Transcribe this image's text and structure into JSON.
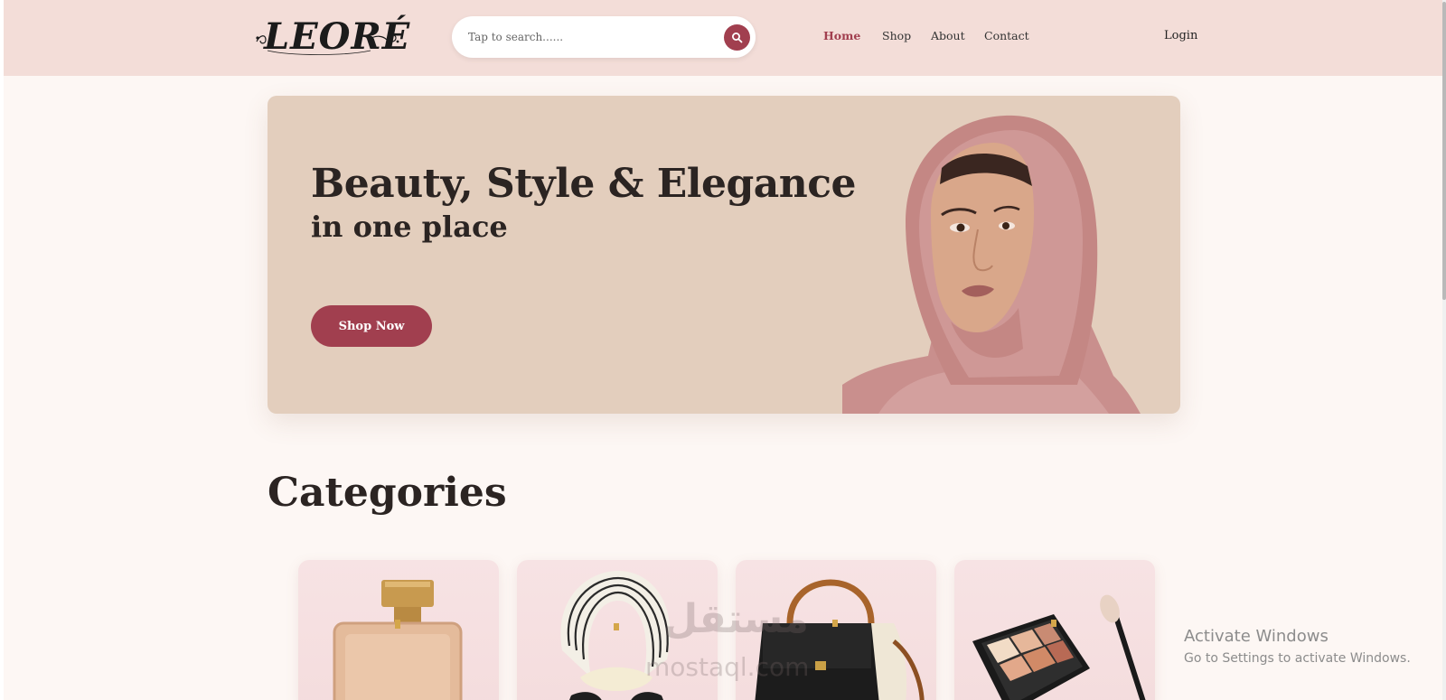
{
  "header": {
    "logo_text": "LEORÉ",
    "search": {
      "placeholder": "Tap to search......"
    },
    "nav": [
      {
        "label": "Home",
        "active": true
      },
      {
        "label": "Shop",
        "active": false
      },
      {
        "label": "About",
        "active": false
      },
      {
        "label": "Contact",
        "active": false
      }
    ],
    "login_label": "Login"
  },
  "hero": {
    "title": "Beauty, Style & Elegance",
    "subtitle": "in one place",
    "cta_label": "Shop Now"
  },
  "categories": {
    "heading": "Categories",
    "cards": [
      {
        "icon": "perfume-bottle-image"
      },
      {
        "icon": "silk-scarf-image"
      },
      {
        "icon": "handbag-image"
      },
      {
        "icon": "makeup-palette-image"
      }
    ]
  },
  "overlays": {
    "watermark_ar": "مستقل",
    "watermark_en": "mostaql.com",
    "activate_title": "Activate Windows",
    "activate_sub": "Go to Settings to activate Windows."
  },
  "colors": {
    "header_bg": "#f3ddd8",
    "page_bg": "#fdf7f4",
    "accent": "#a13f4f",
    "hero_bg": "#e3cebd",
    "text_dark": "#2b2422"
  }
}
